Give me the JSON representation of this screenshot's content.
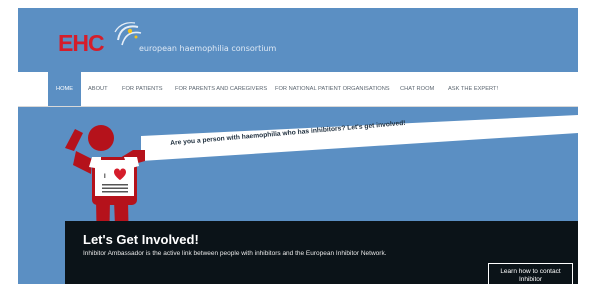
{
  "brand": {
    "logo_text": "EHC",
    "tagline": "european haemophilia consortium"
  },
  "nav": {
    "items": [
      {
        "label": "HOME"
      },
      {
        "label": "ABOUT"
      },
      {
        "label": "FOR PATIENTS"
      },
      {
        "label": "FOR PARENTS AND CAREGIVERS"
      },
      {
        "label": "FOR NATIONAL PATIENT ORGANISATIONS"
      },
      {
        "label": "CHAT ROOM"
      },
      {
        "label": "ASK THE EXPERT!"
      }
    ]
  },
  "banner": {
    "headline": "Are you a person with haemophilia who has inhibitors? Let's get involved!",
    "shirt_text": "I ♥"
  },
  "panel": {
    "title": "Let's Get Involved!",
    "text": "Inhibitor Ambassador is the active link between people with inhibitors and the European Inhibitor Network.",
    "button": "Learn how to contact Inhibitor"
  },
  "colors": {
    "header_bg": "#5b8fc3",
    "logo_red": "#d51d2b",
    "panel_bg": "#0b1318",
    "figure_red": "#b5121b"
  }
}
